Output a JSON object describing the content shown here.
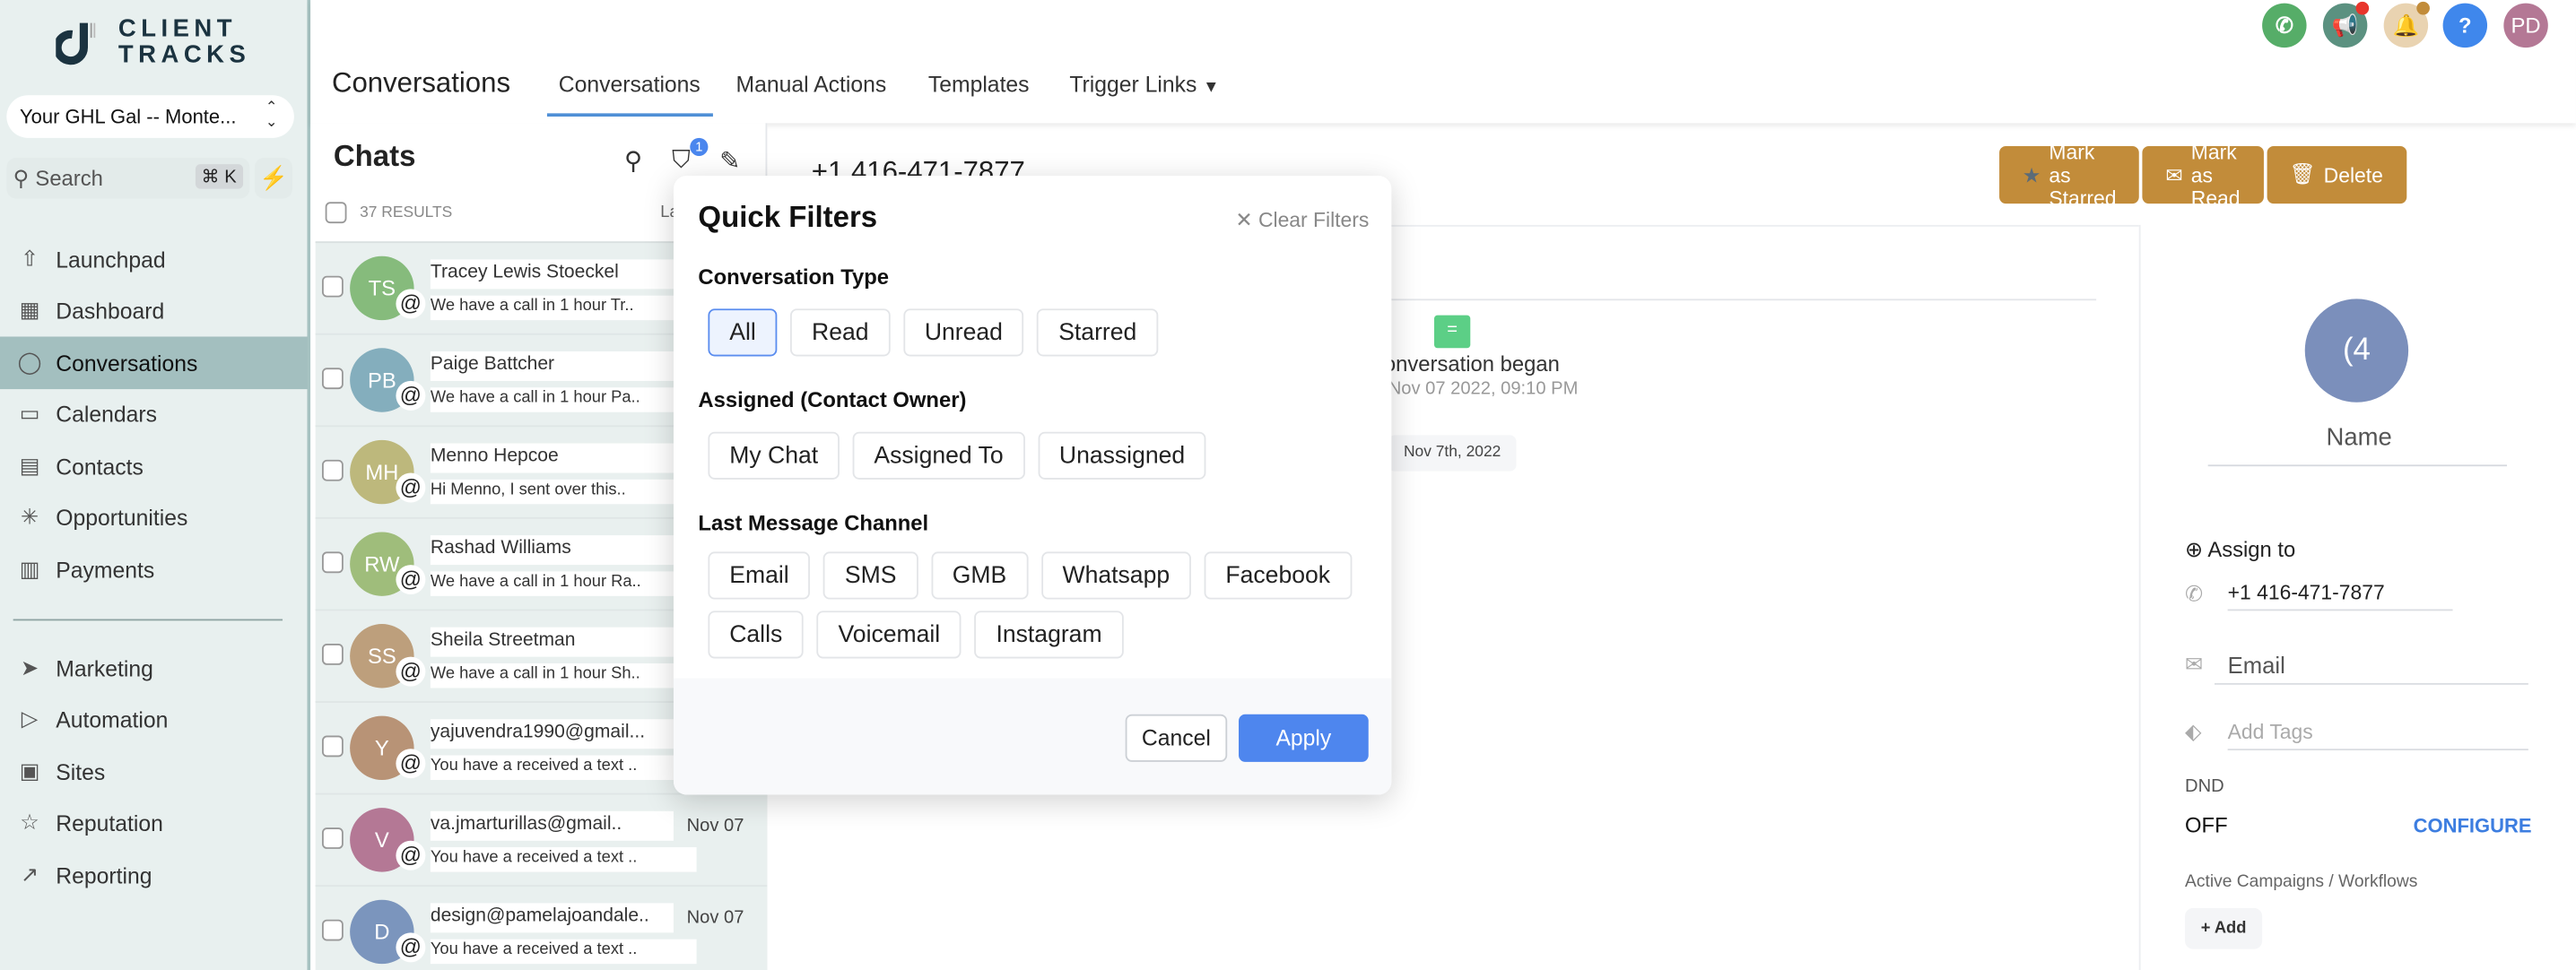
{
  "brand": {
    "line1": "CLIENT",
    "line2": "TRACKS"
  },
  "account": {
    "name": "Your GHL Gal -- Monte..."
  },
  "search": {
    "label": "Search",
    "shortcut": "⌘ K"
  },
  "sidebar": {
    "items": [
      {
        "label": "Launchpad",
        "icon": "rocket-icon",
        "glyph": "⇧"
      },
      {
        "label": "Dashboard",
        "icon": "dashboard-icon",
        "glyph": "▦"
      },
      {
        "label": "Conversations",
        "icon": "chat-bubble-icon",
        "glyph": "◯",
        "active": true
      },
      {
        "label": "Calendars",
        "icon": "calendar-icon",
        "glyph": "▭"
      },
      {
        "label": "Contacts",
        "icon": "contacts-icon",
        "glyph": "▤"
      },
      {
        "label": "Opportunities",
        "icon": "opportunities-icon",
        "glyph": "✳"
      },
      {
        "label": "Payments",
        "icon": "payments-icon",
        "glyph": "▥"
      },
      {
        "label": "Marketing",
        "icon": "send-icon",
        "glyph": "➤"
      },
      {
        "label": "Automation",
        "icon": "automation-icon",
        "glyph": "▷"
      },
      {
        "label": "Sites",
        "icon": "sites-icon",
        "glyph": "▣"
      },
      {
        "label": "Reputation",
        "icon": "star-icon",
        "glyph": "☆"
      },
      {
        "label": "Reporting",
        "icon": "trend-icon",
        "glyph": "↗"
      }
    ]
  },
  "header": {
    "title": "Conversations",
    "tabs": [
      {
        "label": "Conversations",
        "active": true
      },
      {
        "label": "Manual Actions"
      },
      {
        "label": "Templates"
      },
      {
        "label": "Trigger Links",
        "dropdown": true
      }
    ],
    "user_initials": "PD"
  },
  "colors": {
    "accent": "#4e86ee",
    "action": "#c28c3a",
    "sidebar_active": "#a3bfbf",
    "sidebar_bg": "#e8f0ef"
  },
  "chats": {
    "title": "Chats",
    "filter_count": "1",
    "results": "37 RESULTS",
    "sort_label": "La",
    "items": [
      {
        "initials": "TS",
        "name": "Tracey Lewis Stoeckel",
        "preview": "We have a call in 1 hour Tr..",
        "color": "#86bb7c",
        "date": ""
      },
      {
        "initials": "PB",
        "name": "Paige Battcher",
        "preview": "We have a call in 1 hour Pa..",
        "color": "#84aebd",
        "date": ""
      },
      {
        "initials": "MH",
        "name": "Menno Hepcoe",
        "preview": "Hi Menno, I sent over this..",
        "color": "#bdb87c",
        "date": ""
      },
      {
        "initials": "RW",
        "name": "Rashad Williams",
        "preview": "We have a call in 1 hour Ra..",
        "color": "#9fbd7b",
        "date": ""
      },
      {
        "initials": "SS",
        "name": "Sheila Streetman",
        "preview": "We have a call in 1 hour Sh..",
        "color": "#bd9f7c",
        "date": ""
      },
      {
        "initials": "Y",
        "name": "yajuvendra1990@gmail...",
        "preview": "You have a received a text ..",
        "color": "#b89376",
        "date": ""
      },
      {
        "initials": "V",
        "name": "va.jmarturillas@gmail..",
        "preview": "You have a received a text ..",
        "color": "#b47895",
        "date": "Nov 07"
      },
      {
        "initials": "D",
        "name": "design@pamelajoandale..",
        "preview": "You have a received a text ..",
        "color": "#7b95bd",
        "date": "Nov 07"
      }
    ]
  },
  "conversation": {
    "phone": "+1 416-471-7877",
    "actions": {
      "star": "Mark as Starred",
      "read": "Mark as Read",
      "delete": "Delete"
    },
    "began": "Conversation began",
    "began_date": "Nov 07 2022, 09:10 PM",
    "date_pill": "Nov 7th, 2022"
  },
  "contact": {
    "avatar": "(4",
    "name": "Name",
    "assign": "Assign to",
    "phone": "+1 416-471-7877",
    "email_placeholder": "Email",
    "tags_placeholder": "Add Tags",
    "dnd_label": "DND",
    "dnd_value": "OFF",
    "configure": "CONFIGURE",
    "campaigns_label": "Active Campaigns / Workflows",
    "add": "+ Add"
  },
  "quick_filters": {
    "title": "Quick Filters",
    "clear": "Clear Filters",
    "sections": [
      {
        "label": "Conversation Type",
        "options": [
          "All",
          "Read",
          "Unread",
          "Starred"
        ],
        "selected": "All"
      },
      {
        "label": "Assigned (Contact Owner)",
        "options": [
          "My Chat",
          "Assigned To",
          "Unassigned"
        ]
      },
      {
        "label": "Last Message Channel",
        "options": [
          "Email",
          "SMS",
          "GMB",
          "Whatsapp",
          "Facebook",
          "Calls",
          "Voicemail",
          "Instagram"
        ]
      }
    ],
    "cancel": "Cancel",
    "apply": "Apply"
  }
}
